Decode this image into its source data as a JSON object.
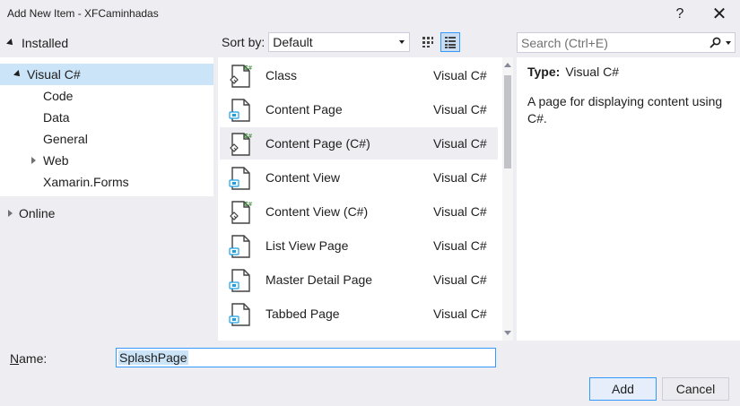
{
  "window": {
    "title": "Add New Item - XFCaminhadas",
    "help_glyph": "?",
    "close_glyph": "✕"
  },
  "left": {
    "installed_label": "Installed",
    "tree": [
      {
        "label": "Visual C#",
        "selected": true
      },
      {
        "label": "Code"
      },
      {
        "label": "Data"
      },
      {
        "label": "General"
      },
      {
        "label": "Web",
        "collapsed": true
      },
      {
        "label": "Xamarin.Forms"
      }
    ],
    "online_label": "Online"
  },
  "toolbar": {
    "sort_label": "Sort by:",
    "sort_value": "Default",
    "view_grid_icon": "grid-view-icon",
    "view_list_icon": "list-view-icon"
  },
  "search": {
    "placeholder": "Search (Ctrl+E)",
    "icon": "search-icon"
  },
  "templates": [
    {
      "name": "Class",
      "type": "Visual C#",
      "icon": "csharp-class-icon"
    },
    {
      "name": "Content Page",
      "type": "Visual C#",
      "icon": "xaml-page-icon"
    },
    {
      "name": "Content Page (C#)",
      "type": "Visual C#",
      "icon": "csharp-page-icon",
      "selected": true
    },
    {
      "name": "Content View",
      "type": "Visual C#",
      "icon": "xaml-page-icon"
    },
    {
      "name": "Content View (C#)",
      "type": "Visual C#",
      "icon": "csharp-page-icon"
    },
    {
      "name": "List View Page",
      "type": "Visual C#",
      "icon": "xaml-page-icon"
    },
    {
      "name": "Master Detail Page",
      "type": "Visual C#",
      "icon": "xaml-page-icon"
    },
    {
      "name": "Tabbed Page",
      "type": "Visual C#",
      "icon": "xaml-page-icon"
    }
  ],
  "details": {
    "type_label": "Type:",
    "type_value": "Visual C#",
    "description": "A page for displaying content using C#."
  },
  "bottom": {
    "name_label": "Name:",
    "name_value": "SplashPage",
    "add_label": "Add",
    "cancel_label": "Cancel"
  },
  "colors": {
    "accent": "#3399ff",
    "selection": "#cce4f7",
    "csharp_green": "#388a34",
    "xaml_blue": "#1ba1e2"
  }
}
